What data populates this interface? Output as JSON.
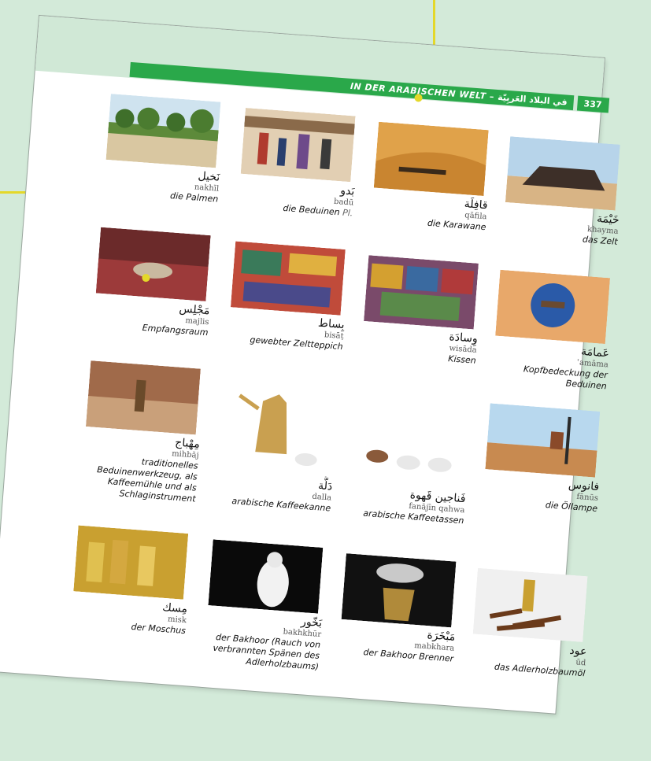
{
  "header": {
    "title_de": "IN DER ARABISCHEN WELT",
    "title_ar": "في البلاد العَربِيّة",
    "separator": "–",
    "page_number": "337"
  },
  "items": [
    {
      "ar": "نَخيل",
      "tr": "nakhīl",
      "de": "die Palmen",
      "de_suffix": "",
      "icon": "palm-trees-photo"
    },
    {
      "ar": "بَدو",
      "tr": "badū",
      "de": "die Beduinen",
      "de_suffix": "Pl.",
      "icon": "bedouins-photo"
    },
    {
      "ar": "قافِلَة",
      "tr": "qāfila",
      "de": "die Karawane",
      "de_suffix": "",
      "icon": "caravan-photo"
    },
    {
      "ar": "خَيْمَة",
      "tr": "khayma",
      "de": "das Zelt",
      "de_suffix": "",
      "icon": "tent-photo"
    },
    {
      "ar": "مَجْلِس",
      "tr": "majlis",
      "de": "Empfangsraum",
      "de_suffix": "",
      "icon": "majlis-photo"
    },
    {
      "ar": "بِساط",
      "tr": "bisāṭ",
      "de": "gewebter Zeltteppich",
      "de_suffix": "",
      "icon": "carpet-photo"
    },
    {
      "ar": "وِسادَة",
      "tr": "wisāda",
      "de": "Kissen",
      "de_suffix": "",
      "icon": "cushions-photo"
    },
    {
      "ar": "عَمامَة",
      "tr": "ʿamāma",
      "de": "Kopfbedeckung der Beduinen",
      "de_suffix": "",
      "icon": "turban-photo"
    },
    {
      "ar": "مِهْباج",
      "tr": "mihbāj",
      "de": "traditionelles Beduinenwerkzeug, als Kaffeemühle und als Schlaginstrument",
      "de_suffix": "",
      "icon": "mortar-photo"
    },
    {
      "ar": "دَلَّة",
      "tr": "dalla",
      "de": "arabische Kaffeekanne",
      "de_suffix": "",
      "icon": "coffee-pot-photo"
    },
    {
      "ar": "فَناجين قَهوة",
      "tr": "fanājīn qahwa",
      "de": "arabische Kaffeetassen",
      "de_suffix": "",
      "icon": "coffee-cups-photo"
    },
    {
      "ar": "فانوس",
      "tr": "fānūs",
      "de": "die Öllampe",
      "de_suffix": "",
      "icon": "lantern-photo"
    },
    {
      "ar": "مِسك",
      "tr": "misk",
      "de": "der Moschus",
      "de_suffix": "",
      "icon": "musk-photo"
    },
    {
      "ar": "بَخّور",
      "tr": "bakhkhūr",
      "de": "der Bakhoor (Rauch von verbrannten Spänen des Adlerholzbaums)",
      "de_suffix": "",
      "icon": "incense-photo"
    },
    {
      "ar": "مَبْخَرَة",
      "tr": "mabkhara",
      "de": "der Bakhoor Brenner",
      "de_suffix": "",
      "icon": "burner-photo"
    },
    {
      "ar": "عود",
      "tr": "ūd",
      "de": "das Adlerholzbaumöl",
      "de_suffix": "",
      "icon": "oud-photo"
    }
  ],
  "colors": {
    "accent_green": "#2aa84a",
    "header_band": "#d0e8d6",
    "callout_yellow": "#e4d82a"
  }
}
